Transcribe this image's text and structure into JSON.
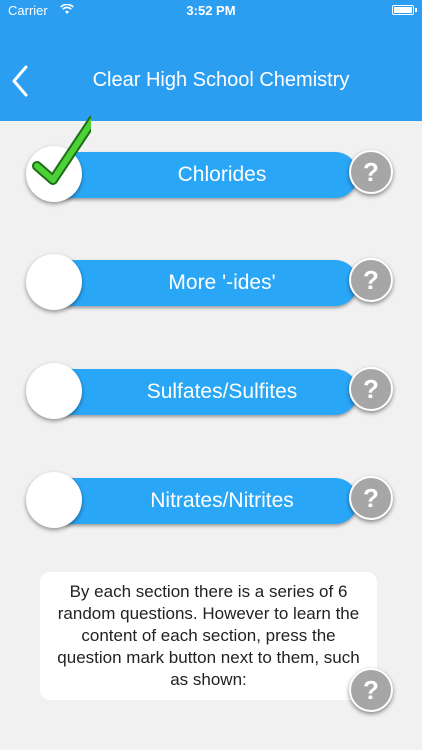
{
  "status_bar": {
    "carrier": "Carrier",
    "time": "3:52 PM"
  },
  "nav": {
    "title": "Clear High School Chemistry",
    "back_icon": "chevron-left-icon"
  },
  "sections": [
    {
      "label": "Chlorides",
      "checked": true
    },
    {
      "label": "More '-ides'",
      "checked": false
    },
    {
      "label": "Sulfates/Sulfites",
      "checked": false
    },
    {
      "label": "Nitrates/Nitrites",
      "checked": false
    }
  ],
  "help_button": {
    "label": "?"
  },
  "info": {
    "text": "By each section there is a series of 6 random questions. However to learn the content of each section, press the question mark button next to them, such as shown:"
  },
  "colors": {
    "header": "#2c9ef2",
    "pill": "#2aa6f7",
    "check": "#4cd137",
    "help": "#a6a6a6"
  }
}
